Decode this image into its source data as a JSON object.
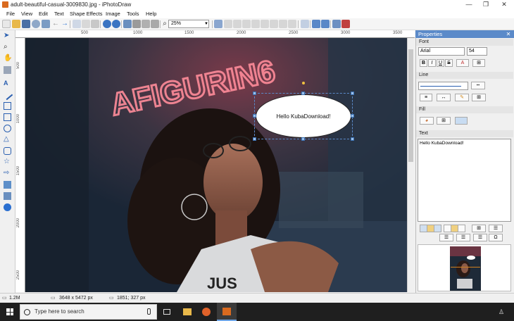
{
  "window": {
    "title": "adult-beautiful-casual-3009830.jpg - iPhotoDraw",
    "minimize": "—",
    "maximize": "❐",
    "close": "✕"
  },
  "menu": [
    "File",
    "View",
    "Edit",
    "Text",
    "Shape Effects",
    "Image",
    "Tools",
    "Help"
  ],
  "toolbar": {
    "zoom_value": "25%"
  },
  "ruler": {
    "top_labels": [
      "500",
      "1000",
      "1500",
      "2000",
      "2500",
      "3000",
      "3500"
    ],
    "left_labels": [
      "500",
      "1000",
      "1500",
      "2000",
      "2500"
    ]
  },
  "canvas": {
    "neon_text": "AFIGURIN6",
    "callout_text": "Hello KubaDownload!",
    "shirt_text": "JUS"
  },
  "properties": {
    "title": "Properties",
    "close": "✕",
    "font_section": "Font",
    "font_name": "Arial",
    "font_size": "54",
    "bold": "B",
    "italic": "I",
    "underline": "U",
    "strike": "S",
    "font_color_icon": "A",
    "line_section": "Line",
    "fill_section": "Fill",
    "text_section": "Text",
    "text_value": "Hello KubaDownload!"
  },
  "status": {
    "file_size": "1.2M",
    "dimensions": "3648 x 5472 px",
    "coords": "1851; 327 px"
  },
  "taskbar": {
    "search_placeholder": "Type here to search"
  },
  "colors": {
    "accent": "#5b8ac9",
    "neon": "#ff5a6e",
    "taskbar": "#1f1f1f"
  }
}
